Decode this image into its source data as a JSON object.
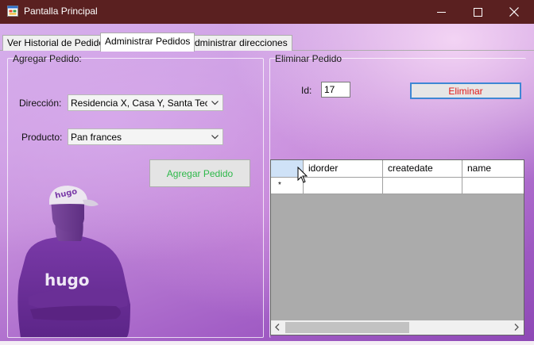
{
  "window": {
    "title": "Pantalla Principal"
  },
  "tabs": [
    {
      "label": "Ver Historial de Pedidos",
      "active": false
    },
    {
      "label": "Administrar Pedidos",
      "active": true
    },
    {
      "label": "Administrar direcciones",
      "active": false
    }
  ],
  "agregar": {
    "legend": "Agregar Pedido:",
    "direccion_label": "Dirección:",
    "direccion_value": "Residencia X, Casa Y, Santa Tecla,",
    "producto_label": "Producto:",
    "producto_value": "Pan frances",
    "button": "Agregar Pedido"
  },
  "eliminar": {
    "legend": "Eliminar Pedido",
    "id_label": "Id:",
    "id_value": "17",
    "button": "Eliminar"
  },
  "grid": {
    "columns": [
      "idorder",
      "createdate",
      "name"
    ],
    "new_row_marker": "*"
  },
  "colors": {
    "titlebar": "#5a2020",
    "agregar_text": "#2eb84a",
    "eliminar_text": "#e11b1b",
    "focus_border": "#3e87d4"
  },
  "icons": [
    "app-icon",
    "minimize-icon",
    "maximize-icon",
    "close-icon",
    "chevron-down-icon",
    "scroll-left-icon",
    "scroll-right-icon",
    "mouse-cursor-icon"
  ]
}
